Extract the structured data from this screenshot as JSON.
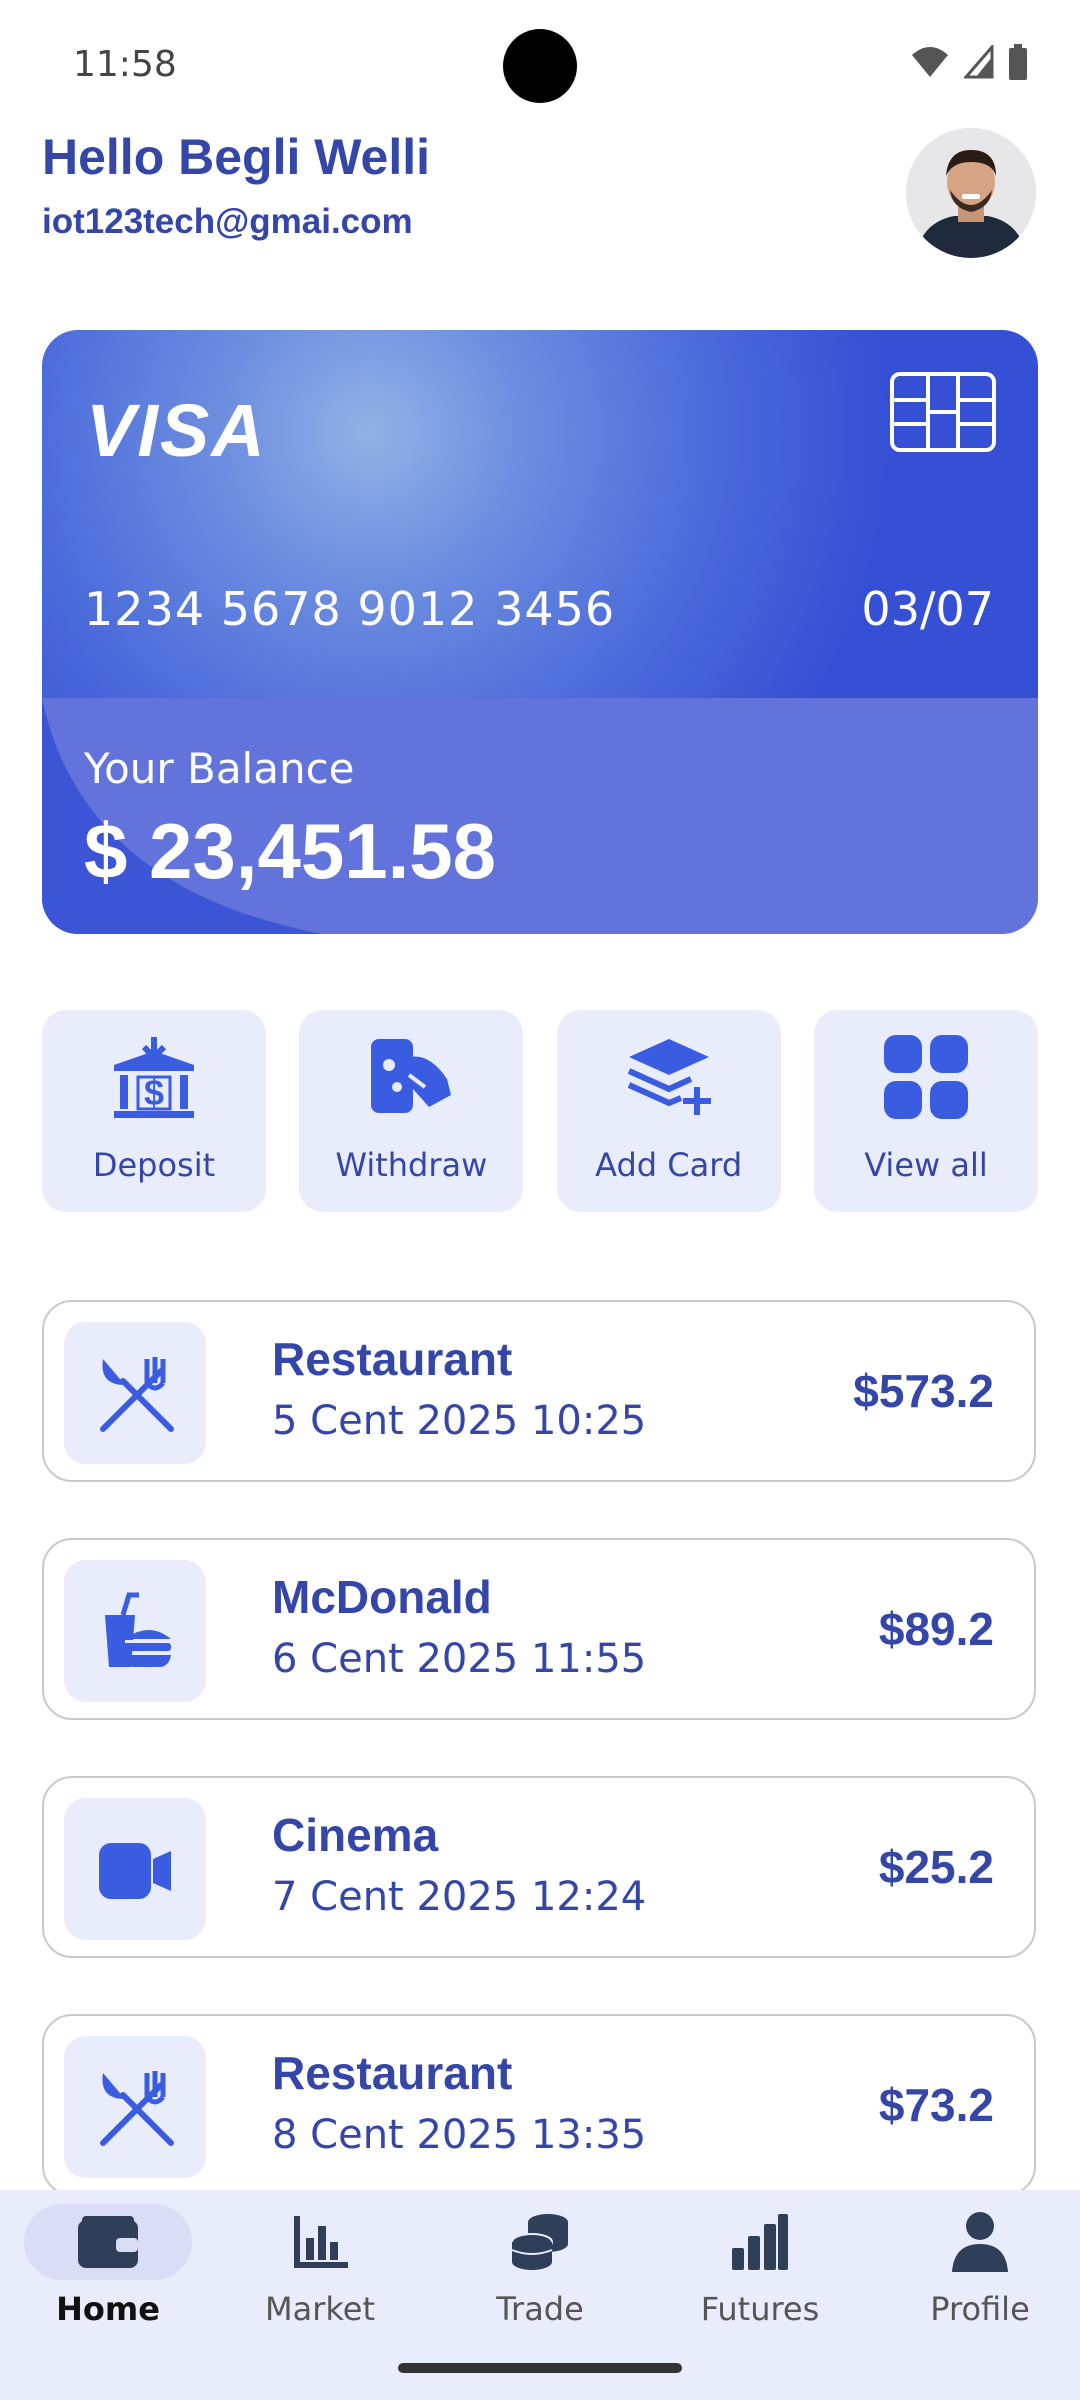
{
  "status": {
    "time": "11:58"
  },
  "header": {
    "greeting": "Hello Begli Welli",
    "email": "iot123tech@gmai.com"
  },
  "card": {
    "brand": "VISA",
    "number": "1234 5678 9012 3456",
    "expiry": "03/07",
    "balance_label": "Your Balance",
    "balance": "$ 23,451.58"
  },
  "actions": [
    {
      "label": "Deposit",
      "icon": "bank-dollar-icon"
    },
    {
      "label": "Withdraw",
      "icon": "cash-hand-icon"
    },
    {
      "label": "Add Card",
      "icon": "stack-add-icon"
    },
    {
      "label": "View all",
      "icon": "grid-icon"
    }
  ],
  "transactions": [
    {
      "title": "Restaurant",
      "date": "5 Cent 2025 10:25",
      "amount": "$573.2",
      "icon": "fork-knife-icon"
    },
    {
      "title": "McDonald",
      "date": "6 Cent 2025 11:55",
      "amount": "$89.2",
      "icon": "fast-food-icon"
    },
    {
      "title": "Cinema",
      "date": "7 Cent 2025 12:24",
      "amount": "$25.2",
      "icon": "video-camera-icon"
    },
    {
      "title": "Restaurant",
      "date": "8 Cent 2025 13:35",
      "amount": "$73.2",
      "icon": "fork-knife-icon"
    }
  ],
  "nav": [
    {
      "label": "Home",
      "icon": "wallet-icon",
      "active": true
    },
    {
      "label": "Market",
      "icon": "bar-chart-icon"
    },
    {
      "label": "Trade",
      "icon": "coins-icon"
    },
    {
      "label": "Futures",
      "icon": "signal-bars-icon"
    },
    {
      "label": "Profile",
      "icon": "person-icon"
    }
  ],
  "colors": {
    "primary": "#3446a8",
    "accent": "#3a5ce0",
    "tile": "#e9ecfb"
  }
}
